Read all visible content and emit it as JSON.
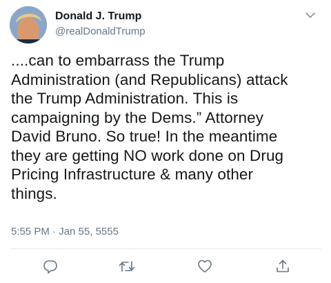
{
  "author": {
    "display_name": "Donald J. Trump",
    "handle": "@realDonaldTrump"
  },
  "tweet": {
    "lines": [
      "....can to embarrass the Trump",
      "Administration (and Republicans) attack",
      "the Trump Administration. This is",
      "campaigning by the Dems.” Attorney",
      "David Bruno. So true! In the meantime",
      "they are getting NO work done on Drug",
      "Pricing Infrastructure & many other",
      "things."
    ],
    "timestamp": "5:55 PM · Jan 55, 5555"
  },
  "icons": {
    "avatar": "profile-photo",
    "menu": "chevron-down-icon",
    "reply": "reply-icon",
    "retweet": "retweet-icon",
    "like": "heart-icon",
    "share": "share-icon"
  },
  "colors": {
    "text": "#14171a",
    "secondary": "#657786",
    "divider": "#e1e8ed"
  }
}
